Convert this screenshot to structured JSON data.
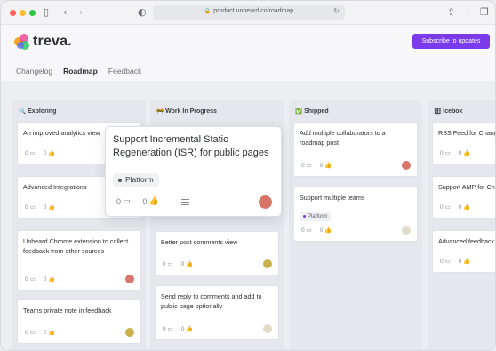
{
  "browser": {
    "url": "product.unheard.co/roadmap",
    "lock_icon": "lock-icon",
    "reload_icon": "reload-icon"
  },
  "app": {
    "logo_text": "treva.",
    "subscribe_label": "Subscribe to updates",
    "accent_color": "#7c3aed",
    "tabs": [
      {
        "label": "Changelog",
        "active": false
      },
      {
        "label": "Roadmap",
        "active": true
      },
      {
        "label": "Feedback",
        "active": false
      }
    ]
  },
  "columns": {
    "exploring": {
      "title": "Exploring",
      "emoji": "🔍",
      "cards": [
        {
          "title": "An improved analytics view",
          "comments": "0",
          "likes": "0"
        },
        {
          "title": "Advanced Integrations",
          "comments": "0",
          "likes": "0"
        },
        {
          "title": "Unheard Chrome extension to collect feedback from other sources",
          "comments": "0",
          "likes": "0"
        },
        {
          "title": "Teams private note in feedback",
          "comments": "0",
          "likes": "0"
        }
      ]
    },
    "wip": {
      "title": "Work In Progress",
      "emoji": "🚧",
      "cards": [
        {
          "title": "Better post comments view",
          "comments": "0",
          "likes": "0"
        },
        {
          "title": "Send reply to comments and add to public page optionally",
          "comments": "0",
          "likes": "0"
        }
      ]
    },
    "shipped": {
      "title": "Shipped",
      "emoji": "✅",
      "cards": [
        {
          "title": "Add multiple collaborators to a roadmap post",
          "comments": "0",
          "likes": "0"
        },
        {
          "title": "Support multiple teams",
          "tag": "Platform",
          "comments": "0",
          "likes": "0"
        }
      ]
    },
    "icebox": {
      "title": "Icebox",
      "emoji": "🗄",
      "cards": [
        {
          "title": "RSS Feed for Changelog",
          "comments": "0",
          "likes": "0"
        },
        {
          "title": "Support AMP for Changelog",
          "comments": "0",
          "likes": "0"
        },
        {
          "title": "Advanced feedback",
          "comments": "0",
          "likes": "0"
        }
      ]
    }
  },
  "dragged_card": {
    "title": "Support Incremental Static Regeneration (ISR) for public pages",
    "tag": "Platform",
    "comments": "0",
    "likes": "0"
  }
}
